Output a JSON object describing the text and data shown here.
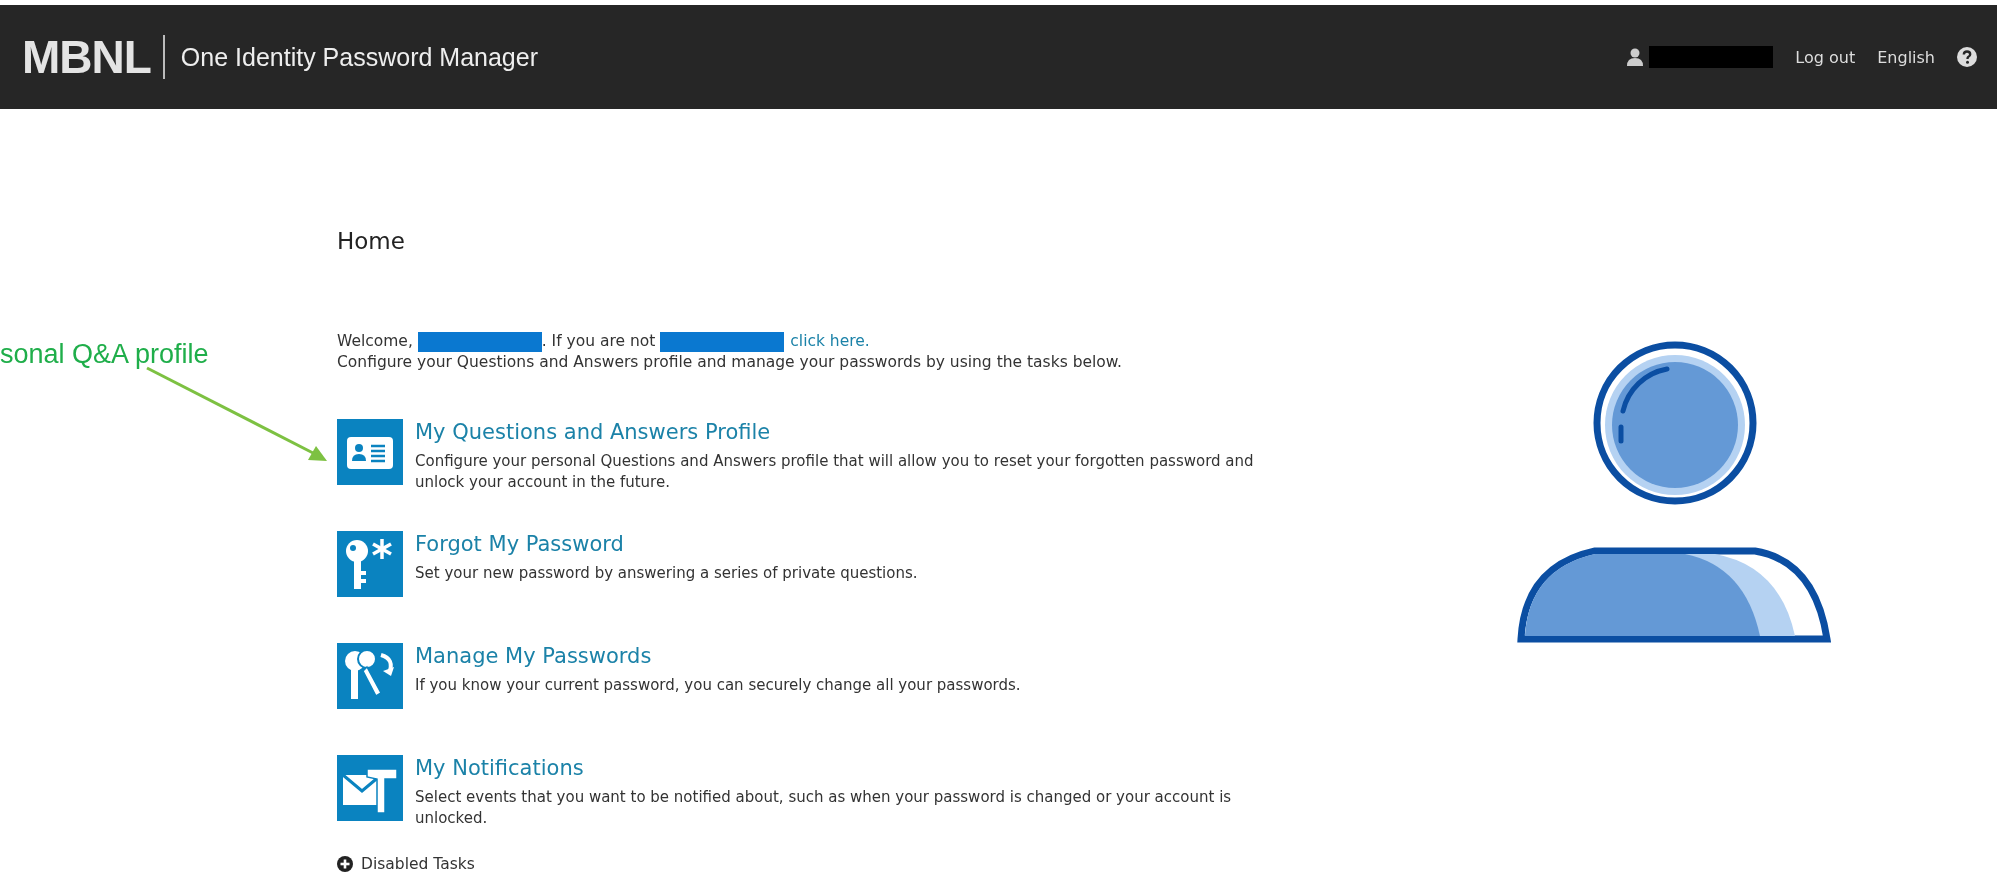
{
  "header": {
    "logo": "MBNL",
    "title": "One Identity Password Manager",
    "links": [
      "Log out",
      "English"
    ]
  },
  "annotation": {
    "text": "sonal Q&A profile"
  },
  "page": {
    "heading": "Home",
    "welcome": {
      "prefix": "Welcome,",
      "middle": ". If you are not",
      "link": "click here."
    },
    "intro": "Configure your Questions and Answers profile and manage your passwords by using the tasks below.",
    "tasks": [
      {
        "kind": "profile",
        "title": "My Questions and Answers Profile",
        "description": "Configure your personal Questions and Answers profile that will allow you to reset your forgotten password and unlock your account in the future."
      },
      {
        "kind": "key",
        "title": "Forgot My Password",
        "description": "Set your new password by answering a series of private questions."
      },
      {
        "kind": "keys",
        "title": "Manage My Passwords",
        "description": "If you know your current password, you can securely change all your passwords."
      },
      {
        "kind": "mail",
        "title": "My Notifications",
        "description": "Select events that you want to be notified about, such as when your password is changed or your account is unlocked."
      }
    ],
    "disabled_tasks": {
      "label": "Disabled Tasks",
      "expanded": false
    }
  }
}
